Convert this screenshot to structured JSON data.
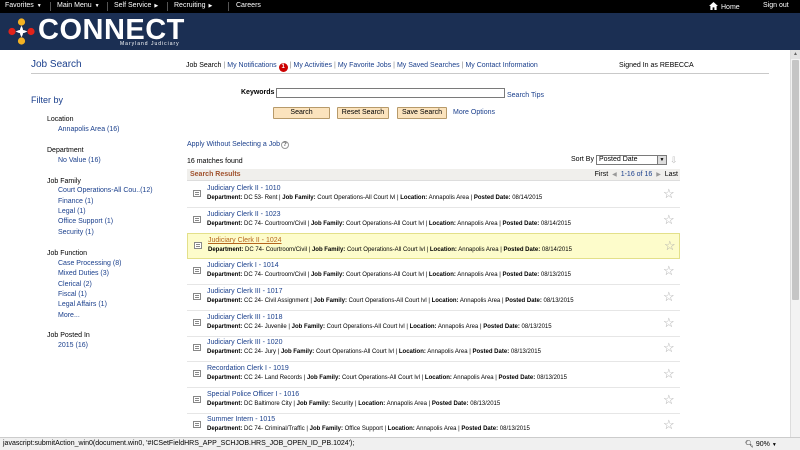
{
  "topnav": {
    "favorites": "Favorites",
    "main_menu": "Main Menu",
    "self_service": "Self Service",
    "recruiting": "Recruiting",
    "careers": "Careers",
    "home": "Home",
    "sign_out": "Sign out"
  },
  "banner": {
    "logo": "CONNECT",
    "subtitle": "Maryland Judiciary"
  },
  "page": {
    "title": "Job Search",
    "signed_in": "Signed In as REBECCA"
  },
  "tabs": [
    {
      "label": "Job Search"
    },
    {
      "label": "My Notifications"
    },
    {
      "label": "My Activities"
    },
    {
      "label": "My Favorite Jobs"
    },
    {
      "label": "My Saved Searches"
    },
    {
      "label": "My Contact Information"
    }
  ],
  "notifications_count": "1",
  "filter": {
    "title": "Filter by",
    "groups": [
      {
        "title": "Location",
        "items": [
          "Annapolis Area (16)"
        ]
      },
      {
        "title": "Department",
        "items": [
          "No Value (16)"
        ]
      },
      {
        "title": "Job Family",
        "items": [
          "Court Operations-All Cou..(12)",
          "Finance (1)",
          "Legal (1)",
          "Office Support (1)",
          "Security (1)"
        ]
      },
      {
        "title": "Job Function",
        "items": [
          "Case Processing (8)",
          "Mixed Duties (3)",
          "Clerical (2)",
          "Fiscal (1)",
          "Legal Affairs (1)",
          "More..."
        ]
      },
      {
        "title": "Job Posted In",
        "items": [
          "2015 (16)"
        ]
      }
    ]
  },
  "search": {
    "keywords_label": "Keywords",
    "keywords_value": "",
    "search_tips": "Search Tips",
    "search_button": "Search",
    "reset_button": "Reset Search",
    "save_button": "Save Search",
    "more_options": "More Options"
  },
  "apply_without": "Apply Without Selecting a Job",
  "matches": "16 matches found",
  "sort": {
    "label": "Sort By",
    "value": "Posted Date"
  },
  "results": {
    "title": "Search Results",
    "pager_first": "First",
    "pager_range": "1-16 of 16",
    "pager_last": "Last",
    "labels": {
      "department": "Department:",
      "job_family": "Job Family:",
      "location": "Location:",
      "posted_date": "Posted Date:"
    },
    "rows": [
      {
        "title": "Judiciary Clerk II - 1010",
        "department": "DC 53- Rent",
        "job_family": "Court Operations-All Court lvl",
        "location": "Annapolis Area",
        "posted_date": "08/14/2015"
      },
      {
        "title": "Judiciary Clerk II - 1023",
        "department": "DC 74- Courtroom/Civil",
        "job_family": "Court Operations-All Court lvl",
        "location": "Annapolis Area",
        "posted_date": "08/14/2015"
      },
      {
        "title": "Judiciary Clerk II - 1024",
        "department": "DC 74- Courtroom/Civil",
        "job_family": "Court Operations-All Court lvl",
        "location": "Annapolis Area",
        "posted_date": "08/14/2015"
      },
      {
        "title": "Judiciary Clerk I - 1014",
        "department": "DC 74- Courtroom/Civil",
        "job_family": "Court Operations-All Court lvl",
        "location": "Annapolis Area",
        "posted_date": "08/13/2015"
      },
      {
        "title": "Judiciary Clerk III - 1017",
        "department": "CC 24- Civil Assignment",
        "job_family": "Court Operations-All Court lvl",
        "location": "Annapolis Area",
        "posted_date": "08/13/2015"
      },
      {
        "title": "Judiciary Clerk III - 1018",
        "department": "CC 24- Juvenile",
        "job_family": "Court Operations-All Court lvl",
        "location": "Annapolis Area",
        "posted_date": "08/13/2015"
      },
      {
        "title": "Judiciary Clerk III - 1020",
        "department": "CC 24- Jury",
        "job_family": "Court Operations-All Court lvl",
        "location": "Annapolis Area",
        "posted_date": "08/13/2015"
      },
      {
        "title": "Recordation Clerk I - 1019",
        "department": "CC 24- Land Records",
        "job_family": "Court Operations-All Court lvl",
        "location": "Annapolis Area",
        "posted_date": "08/13/2015"
      },
      {
        "title": "Special Police Officer I - 1016",
        "department": "DC Baltimore City",
        "job_family": "Security",
        "location": "Annapolis Area",
        "posted_date": "08/13/2015"
      },
      {
        "title": "Summer Intern - 1015",
        "department": "DC 74- Criminal/Traffic",
        "job_family": "Office Support",
        "location": "Annapolis Area",
        "posted_date": "08/13/2015"
      }
    ]
  },
  "statusbar": {
    "text": "javascript:submitAction_win0(document.win0, '#ICSetFieldHRS_APP_SCHJOB.HRS_JOB_OPEN_ID_PB.1024');",
    "zoom": "90%"
  }
}
